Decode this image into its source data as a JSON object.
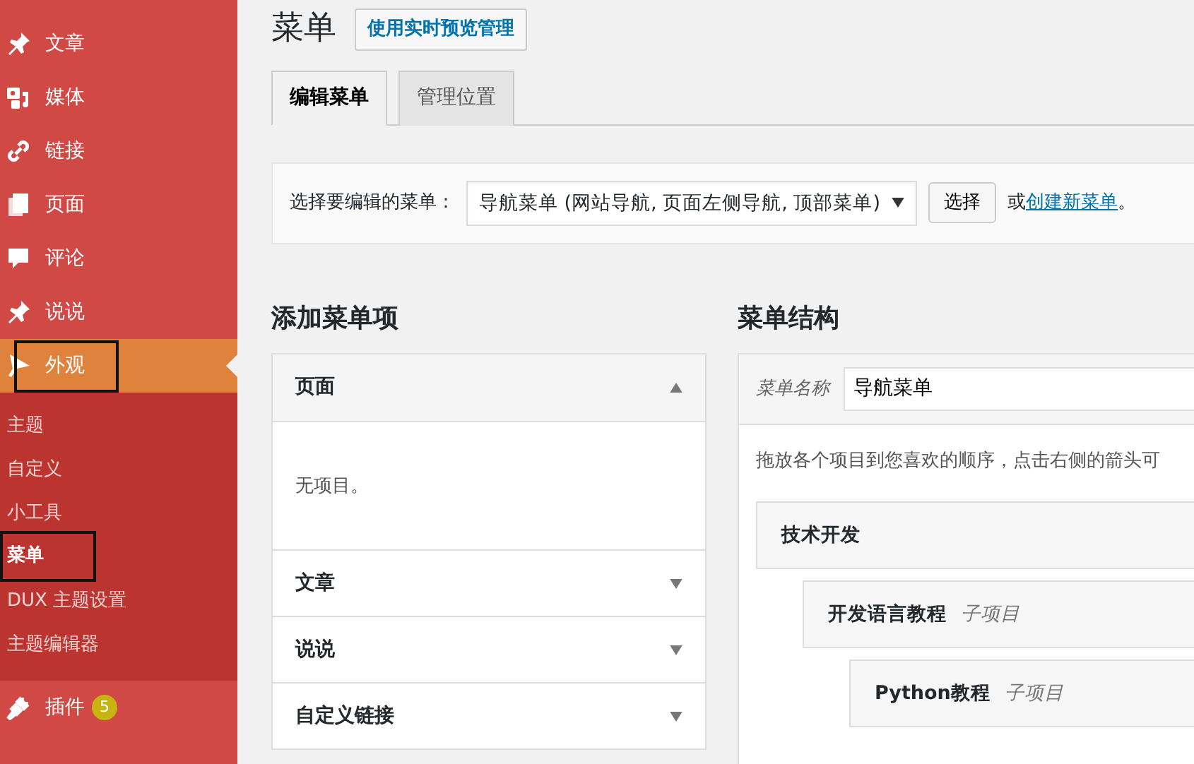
{
  "sidebar": {
    "items": [
      {
        "label": "文章",
        "selected": false
      },
      {
        "label": "媒体",
        "selected": false
      },
      {
        "label": "链接",
        "selected": false
      },
      {
        "label": "页面",
        "selected": false
      },
      {
        "label": "评论",
        "selected": false
      },
      {
        "label": "说说",
        "selected": false
      },
      {
        "label": "外观",
        "selected": true,
        "annotated": true,
        "children": [
          {
            "label": "主题",
            "selected": false,
            "annotated": false
          },
          {
            "label": "自定义",
            "selected": false,
            "annotated": false
          },
          {
            "label": "小工具",
            "selected": false,
            "annotated": false
          },
          {
            "label": "菜单",
            "selected": true,
            "annotated": true
          },
          {
            "label": "DUX 主题设置",
            "selected": false,
            "annotated": false
          },
          {
            "label": "主题编辑器",
            "selected": false,
            "annotated": false
          }
        ]
      },
      {
        "label": "插件",
        "selected": false,
        "badge": "5"
      }
    ]
  },
  "header": {
    "title": "菜单",
    "action_button": "使用实时预览管理"
  },
  "tabs": [
    {
      "label": "编辑菜单",
      "selected": true
    },
    {
      "label": "管理位置",
      "selected": false
    }
  ],
  "menu_select": {
    "label": "选择要编辑的菜单：",
    "value": "导航菜单 (网站导航, 页面左侧导航, 顶部菜单)",
    "button": "选择",
    "or_text": "或",
    "create_link": "创建新菜单",
    "trailing": "。"
  },
  "add_items": {
    "title": "添加菜单项",
    "sections": [
      {
        "title": "页面",
        "expanded": true,
        "body": "无项目。"
      },
      {
        "title": "文章",
        "expanded": false
      },
      {
        "title": "说说",
        "expanded": false
      },
      {
        "title": "自定义链接",
        "expanded": false
      }
    ]
  },
  "structure": {
    "title": "菜单结构",
    "name_label": "菜单名称",
    "name_value": "导航菜单",
    "instructions": "拖放各个项目到您喜欢的顺序，点击右侧的箭头可",
    "items": [
      {
        "title": "技术开发",
        "children": [
          {
            "title": "开发语言教程",
            "sub_label": "子项目",
            "children": [
              {
                "title": "Python教程",
                "sub_label": "子项目"
              }
            ]
          }
        ]
      }
    ]
  }
}
